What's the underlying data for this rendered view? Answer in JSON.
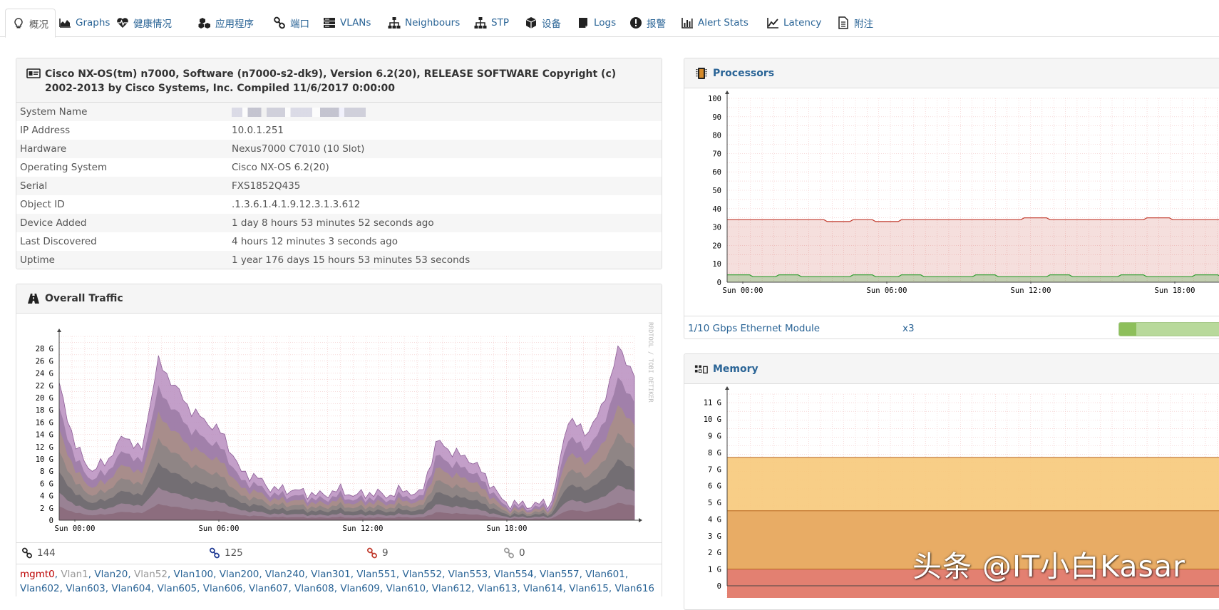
{
  "tabs": [
    {
      "label": "概况",
      "icon": "lightbulb-icon",
      "active": true
    },
    {
      "label": "Graphs",
      "icon": "area-chart-icon"
    },
    {
      "label": "健康情况",
      "icon": "heartbeat-icon"
    },
    {
      "label": "应用程序",
      "icon": "cubes-icon"
    },
    {
      "label": "端口",
      "icon": "link-icon"
    },
    {
      "label": "VLANs",
      "icon": "server-icon"
    },
    {
      "label": "Neighbours",
      "icon": "sitemap-icon"
    },
    {
      "label": "STP",
      "icon": "sitemap-icon"
    },
    {
      "label": "设备",
      "icon": "cube-icon"
    },
    {
      "label": "Logs",
      "icon": "book-icon"
    },
    {
      "label": "报警",
      "icon": "exclamation-circle-icon"
    },
    {
      "label": "Alert Stats",
      "icon": "bar-chart-icon"
    },
    {
      "label": "Latency",
      "icon": "line-chart-icon"
    },
    {
      "label": "附注",
      "icon": "file-text-icon"
    }
  ],
  "device": {
    "title": "Cisco NX-OS(tm) n7000, Software (n7000-s2-dk9), Version 6.2(20), RELEASE SOFTWARE Copyright (c) 2002-2013 by Cisco Systems, Inc. Compiled 11/6/2017 0:00:00",
    "rows": [
      {
        "key": "System Name",
        "value": ""
      },
      {
        "key": "IP Address",
        "value": "10.0.1.251"
      },
      {
        "key": "Hardware",
        "value": "Nexus7000 C7010 (10 Slot)"
      },
      {
        "key": "Operating System",
        "value": "Cisco NX-OS 6.2(20)"
      },
      {
        "key": "Serial",
        "value": "FXS1852Q435"
      },
      {
        "key": "Object ID",
        "value": ".1.3.6.1.4.1.9.12.3.1.3.612"
      },
      {
        "key": "Device Added",
        "value": "1 day 8 hours 53 minutes 52 seconds ago"
      },
      {
        "key": "Last Discovered",
        "value": "4 hours 12 minutes 3 seconds ago"
      },
      {
        "key": "Uptime",
        "value": "1 year 176 days 15 hours 53 minutes 53 seconds"
      }
    ]
  },
  "traffic": {
    "title": "Overall Traffic",
    "watermark": "RRDTOOL / TOBI OETIKER",
    "ports": [
      {
        "icon": "link-icon",
        "color": "#222222",
        "count": "144"
      },
      {
        "icon": "link-icon",
        "color": "#1f3a93",
        "count": "125"
      },
      {
        "icon": "link-icon",
        "color": "#c0392b",
        "count": "9"
      },
      {
        "icon": "link-icon",
        "color": "#999999",
        "count": "0"
      }
    ],
    "vlans": [
      {
        "name": "mgmt0",
        "status": "red"
      },
      {
        "name": "Vlan1",
        "status": "grey"
      },
      {
        "name": "Vlan20",
        "status": "up"
      },
      {
        "name": "Vlan52",
        "status": "grey"
      },
      {
        "name": "Vlan100",
        "status": "up"
      },
      {
        "name": "Vlan200",
        "status": "up"
      },
      {
        "name": "Vlan240",
        "status": "up"
      },
      {
        "name": "Vlan301",
        "status": "up"
      },
      {
        "name": "Vlan551",
        "status": "up"
      },
      {
        "name": "Vlan552",
        "status": "up"
      },
      {
        "name": "Vlan553",
        "status": "up"
      },
      {
        "name": "Vlan554",
        "status": "up"
      },
      {
        "name": "Vlan557",
        "status": "up"
      },
      {
        "name": "Vlan601",
        "status": "up"
      },
      {
        "name": "Vlan602",
        "status": "up"
      },
      {
        "name": "Vlan603",
        "status": "up"
      },
      {
        "name": "Vlan604",
        "status": "up"
      },
      {
        "name": "Vlan605",
        "status": "up"
      },
      {
        "name": "Vlan606",
        "status": "up"
      },
      {
        "name": "Vlan607",
        "status": "up"
      },
      {
        "name": "Vlan608",
        "status": "up"
      },
      {
        "name": "Vlan609",
        "status": "up"
      },
      {
        "name": "Vlan610",
        "status": "up"
      },
      {
        "name": "Vlan612",
        "status": "up"
      },
      {
        "name": "Vlan613",
        "status": "up"
      },
      {
        "name": "Vlan614",
        "status": "up"
      },
      {
        "name": "Vlan615",
        "status": "up"
      },
      {
        "name": "Vlan616",
        "status": "up"
      }
    ]
  },
  "processors": {
    "title": "Processors",
    "module_name": "1/10 Gbps Ethernet Module",
    "module_count": "x3",
    "module_usage": 0.15
  },
  "memory": {
    "title": "Memory"
  },
  "watermark_text": "头条 @IT小白Kasar",
  "chart_data": [
    {
      "type": "area",
      "title": "Overall Traffic",
      "x_ticks": [
        "Sun 00:00",
        "Sun 06:00",
        "Sun 12:00",
        "Sun 18:00"
      ],
      "y_ticks": [
        "0",
        "2 G",
        "4 G",
        "6 G",
        "8 G",
        "10 G",
        "12 G",
        "14 G",
        "16 G",
        "18 G",
        "20 G",
        "22 G",
        "24 G",
        "26 G",
        "28 G"
      ],
      "ylim": [
        0,
        30
      ],
      "series": [
        {
          "values": [
            22,
            12,
            8,
            10,
            14,
            11,
            26,
            22,
            18,
            16,
            14,
            8,
            7,
            5,
            5,
            4.5,
            4,
            5,
            4,
            4.5,
            4,
            5,
            4,
            13,
            11,
            10,
            7,
            3,
            2.5,
            2.5,
            3,
            17,
            14,
            18,
            28,
            24
          ]
        }
      ]
    },
    {
      "type": "area",
      "title": "Processors",
      "x_ticks": [
        "Sun 00:00",
        "Sun 06:00",
        "Sun 12:00",
        "Sun 18:00"
      ],
      "y_ticks": [
        "0",
        "10",
        "20",
        "30",
        "40",
        "50",
        "60",
        "70",
        "80",
        "90",
        "100"
      ],
      "ylim": [
        0,
        100
      ],
      "series": [
        {
          "color": "#c0392b",
          "values": [
            34,
            34,
            34,
            34,
            33,
            34,
            33,
            34,
            34,
            34,
            34,
            34,
            35,
            34,
            34,
            34,
            34,
            35,
            34,
            34,
            34
          ]
        },
        {
          "color": "#2e9e2e",
          "values": [
            4,
            3,
            4,
            3,
            3,
            4,
            3,
            4,
            3,
            3,
            4,
            3,
            3,
            4,
            3,
            3,
            4,
            3,
            3,
            4,
            3
          ]
        }
      ]
    },
    {
      "type": "area",
      "title": "Memory",
      "y_ticks": [
        "0",
        "1 G",
        "2 G",
        "3 G",
        "4 G",
        "5 G",
        "6 G",
        "7 G",
        "8 G",
        "9 G",
        "10 G",
        "11 G"
      ],
      "ylim": [
        0,
        11.5
      ],
      "series": [
        {
          "color": "#f7c97a",
          "values": [
            7.7,
            7.7
          ]
        },
        {
          "color": "#e6a862",
          "values": [
            4.5,
            4.5
          ]
        },
        {
          "color": "#e27b72",
          "values": [
            1.0,
            1.0
          ]
        }
      ]
    }
  ]
}
